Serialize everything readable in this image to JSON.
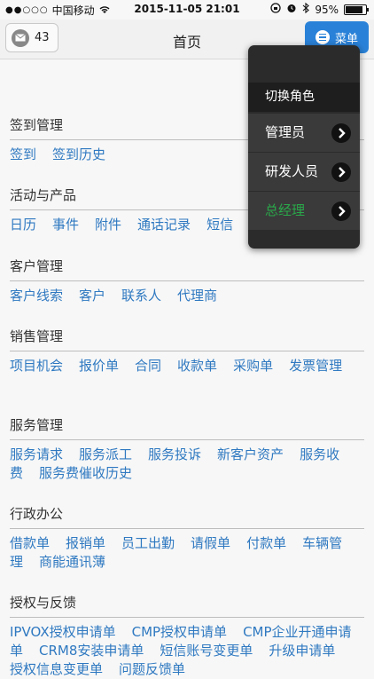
{
  "status_bar": {
    "carrier": "中国移动",
    "time": "2015-11-05 21:01",
    "battery": "95%",
    "battery_level": 0.95
  },
  "nav": {
    "message_count": "43",
    "title": "首页",
    "menu_label": "菜单"
  },
  "sections": [
    {
      "title": "签到管理",
      "links": [
        "签到",
        "签到历史"
      ]
    },
    {
      "title": "活动与产品",
      "links": [
        "日历",
        "事件",
        "附件",
        "通话记录",
        "短信"
      ]
    },
    {
      "title": "客户管理",
      "links": [
        "客户线索",
        "客户",
        "联系人",
        "代理商"
      ]
    },
    {
      "title": "销售管理",
      "links": [
        "项目机会",
        "报价单",
        "合同",
        "收款单",
        "采购单",
        "发票管理"
      ]
    },
    {
      "title": "服务管理",
      "links": [
        "服务请求",
        "服务派工",
        "服务投诉",
        "新客户资产",
        "服务收费",
        "服务费催收历史"
      ]
    },
    {
      "title": "行政办公",
      "links": [
        "借款单",
        "报销单",
        "员工出勤",
        "请假单",
        "付款单",
        "车辆管理",
        "商能通讯薄"
      ]
    },
    {
      "title": "授权与反馈",
      "links": [
        "IPVOX授权申请单",
        "CMP授权申请单",
        "CMP企业开通申请单",
        "CRM8安装申请单",
        "短信账号变更单",
        "升级申请单",
        "授权信息变更单",
        "问题反馈单"
      ]
    }
  ],
  "popup": {
    "header": "切换角色",
    "items": [
      "管理员",
      "研发人员",
      "总经理"
    ],
    "active_index": 2
  }
}
